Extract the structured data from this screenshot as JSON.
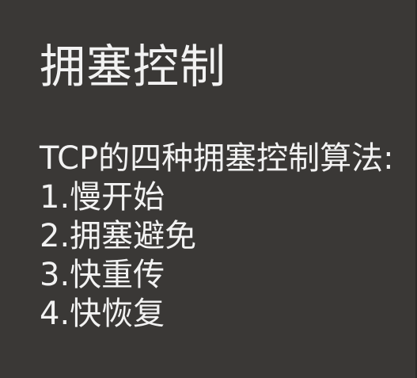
{
  "slide": {
    "title": "拥塞控制",
    "subtitle": "TCP的四种拥塞控制算法:",
    "items": [
      "1.慢开始",
      "2.拥塞避免",
      "3.快重传",
      "4.快恢复"
    ]
  },
  "colors": {
    "background": "#3a3836",
    "text": "#f2f2f2"
  }
}
